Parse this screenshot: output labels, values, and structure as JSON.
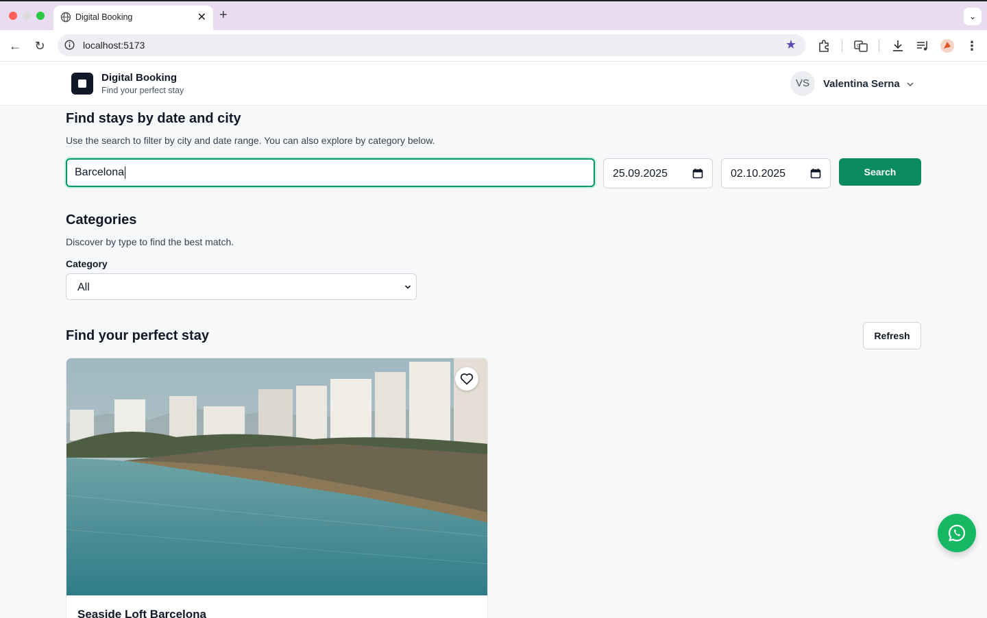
{
  "browser": {
    "tab_title": "Digital Booking",
    "url": "localhost:5173"
  },
  "header": {
    "brand_name": "Digital Booking",
    "brand_tagline": "Find your perfect stay",
    "user_initials": "VS",
    "user_name": "Valentina Serna"
  },
  "search": {
    "title": "Find stays by date and city",
    "subtitle": "Use the search to filter by city and date range. You can also explore by category below.",
    "city_value": "Barcelona",
    "check_in": "25.09.2025",
    "check_out": "02.10.2025",
    "button_label": "Search"
  },
  "categories": {
    "title": "Categories",
    "subtitle": "Discover by type to find the best match.",
    "label": "Category",
    "selected": "All"
  },
  "listings": {
    "title": "Find your perfect stay",
    "refresh_label": "Refresh",
    "items": [
      {
        "title": "Seaside Loft Barcelona"
      }
    ]
  },
  "colors": {
    "accent": "#0a8a5f",
    "whatsapp": "#17b863"
  }
}
